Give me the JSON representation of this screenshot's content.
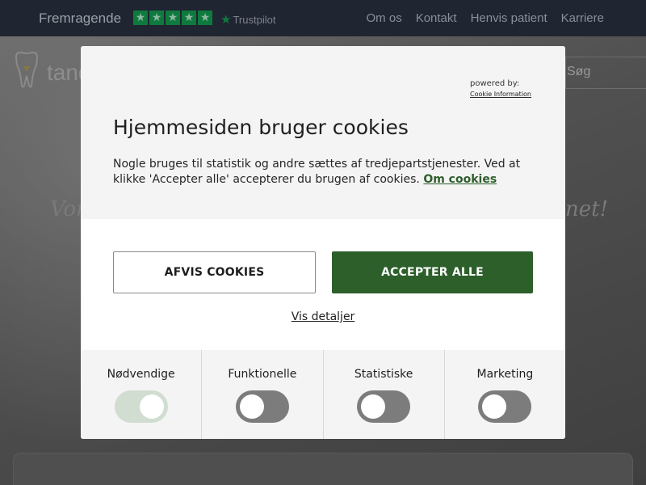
{
  "topbar": {
    "rating_text": "Fremragende",
    "trustpilot_label": "Trustpilot",
    "nav": [
      "Om os",
      "Kontakt",
      "Henvis patient",
      "Karriere"
    ]
  },
  "header": {
    "logo_text": "tand",
    "search_label": "Søg"
  },
  "hero": {
    "text_left": "Vor",
    "text_right": "net!"
  },
  "cookie_dialog": {
    "powered_by": "powered by:",
    "powered_by_link": "Cookie Information",
    "title": "Hjemmesiden bruger cookies",
    "body": "Nogle bruges til statistik og andre sættes af tredjepartstjenester. Ved at klikke 'Accepter alle' accepterer du brugen af cookies.",
    "about_link": "Om cookies",
    "reject_label": "AFVIS COOKIES",
    "accept_label": "ACCEPTER ALLE",
    "details_label": "Vis detaljer",
    "categories": [
      {
        "label": "Nødvendige",
        "enabled": true
      },
      {
        "label": "Funktionelle",
        "enabled": false
      },
      {
        "label": "Statistiske",
        "enabled": false
      },
      {
        "label": "Marketing",
        "enabled": false
      }
    ]
  },
  "colors": {
    "accent_green": "#2d5f2b",
    "trustpilot_green": "#0e7a3e",
    "topbar_bg": "#1f2531"
  }
}
